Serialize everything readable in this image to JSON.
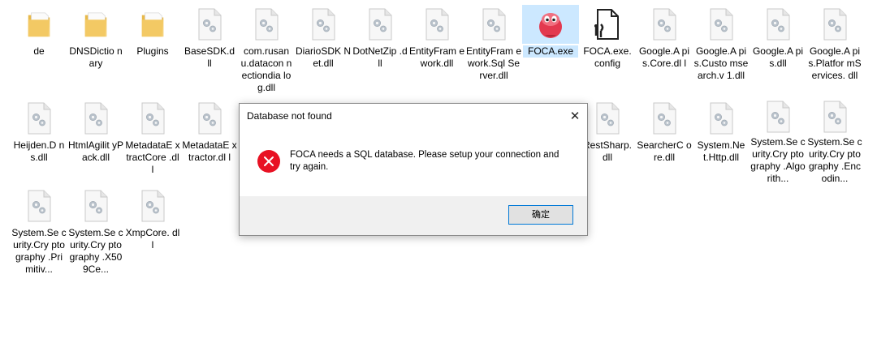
{
  "files": {
    "row1": [
      {
        "label": "de",
        "icon": "folder-icon"
      },
      {
        "label": "DNSDictio nary",
        "icon": "folder-icon"
      },
      {
        "label": "Plugins",
        "icon": "folder-icon"
      },
      {
        "label": "BaseSDK.d ll",
        "icon": "dll-file-icon"
      },
      {
        "label": "com.rusan u.datacon nectiondia log.dll",
        "icon": "dll-file-icon"
      },
      {
        "label": "DiarioSDK Net.dll",
        "icon": "dll-file-icon"
      },
      {
        "label": "DotNetZip .dll",
        "icon": "dll-file-icon"
      },
      {
        "label": "EntityFram ework.dll",
        "icon": "dll-file-icon"
      },
      {
        "label": "EntityFram ework.Sql Server.dll",
        "icon": "dll-file-icon"
      },
      {
        "label": "FOCA.exe",
        "icon": "foca-app-icon",
        "selected": true
      },
      {
        "label": "FOCA.exe. config",
        "icon": "config-file-icon"
      },
      {
        "label": "Google.A pis.Core.dl l",
        "icon": "dll-file-icon"
      },
      {
        "label": "Google.A pis.Custo msearch.v 1.dll",
        "icon": "dll-file-icon"
      },
      {
        "label": "Google.A pis.dll",
        "icon": "dll-file-icon"
      },
      {
        "label": "Google.A pis.Platfor mServices. dll",
        "icon": "dll-file-icon"
      }
    ],
    "row2": [
      {
        "label": "Heijden.D ns.dll",
        "icon": "dll-file-icon"
      },
      {
        "label": "HtmlAgilit yPack.dll",
        "icon": "dll-file-icon"
      },
      {
        "label": "MetadataE xtractCore .dll",
        "icon": "dll-file-icon"
      },
      {
        "label": "MetadataE xtractor.dl l",
        "icon": "dll-file-icon"
      },
      {
        "label": "",
        "icon": "dll-file-icon",
        "hidden": true
      },
      {
        "label": "",
        "icon": "dll-file-icon",
        "hidden": true
      },
      {
        "label": "",
        "icon": "dll-file-icon",
        "hidden": true
      },
      {
        "label": "",
        "icon": "dll-file-icon",
        "hidden": true
      },
      {
        "label": "",
        "icon": "dll-file-icon",
        "hidden": true
      },
      {
        "label": "",
        "icon": "dll-file-icon",
        "hidden": true
      },
      {
        "label": "RestSharp. dll",
        "icon": "dll-file-icon"
      },
      {
        "label": "SearcherC ore.dll",
        "icon": "dll-file-icon"
      },
      {
        "label": "System.Ne t.Http.dll",
        "icon": "dll-file-icon"
      },
      {
        "label": "System.Se curity.Cry ptography .Algorith...",
        "icon": "dll-file-icon"
      },
      {
        "label": "System.Se curity.Cry ptography .Encodin...",
        "icon": "dll-file-icon"
      }
    ],
    "row3": [
      {
        "label": "System.Se curity.Cry ptography .Primitiv...",
        "icon": "dll-file-icon"
      },
      {
        "label": "System.Se curity.Cry ptography .X509Ce...",
        "icon": "dll-file-icon"
      },
      {
        "label": "XmpCore. dll",
        "icon": "dll-file-icon"
      }
    ]
  },
  "dialog": {
    "title": "Database not found",
    "close_label": "✕",
    "message": "FOCA needs a SQL database. Please setup your connection and try again.",
    "ok_label": "确定",
    "icon": "error-icon"
  },
  "colors": {
    "selection": "#cce8ff",
    "error_red": "#e81123",
    "ok_border": "#0078d7",
    "footer_bg": "#f0f0f0"
  }
}
